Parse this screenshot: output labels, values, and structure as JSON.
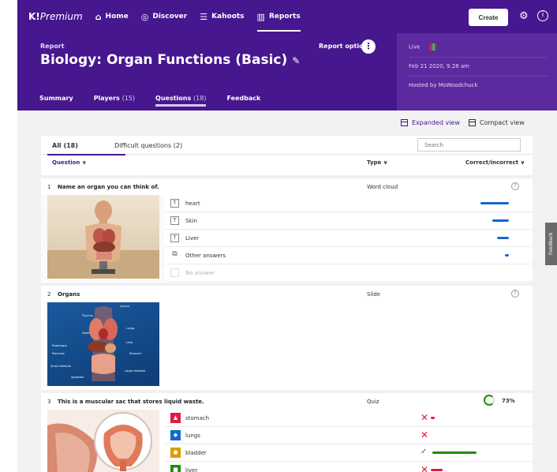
{
  "nav": {
    "logo_k": "K!",
    "logo_premium": "Premium",
    "items": [
      {
        "icon": "home-icon",
        "glyph": "⌂",
        "label": "Home"
      },
      {
        "icon": "compass-icon",
        "glyph": "◎",
        "label": "Discover"
      },
      {
        "icon": "list-icon",
        "glyph": "☰",
        "label": "Kahoots"
      },
      {
        "icon": "bar-chart-icon",
        "glyph": "▥",
        "label": "Reports"
      }
    ],
    "create_label": "Create"
  },
  "header": {
    "kicker": "Report",
    "title": "Biology: Organ Functions (Basic)",
    "report_options": "Report options",
    "tabs": [
      {
        "label": "Summary",
        "count": ""
      },
      {
        "label": "Players",
        "count": "(15)"
      },
      {
        "label": "Questions",
        "count": "(18)"
      },
      {
        "label": "Feedback",
        "count": ""
      }
    ],
    "live": "Live",
    "date": "Feb 21 2020, 9.28 am",
    "host": "Hosted by MsWoodchuck"
  },
  "views": {
    "expanded": "Expanded view",
    "compact": "Compact view"
  },
  "subtabs": {
    "all": "All (18)",
    "difficult": "Difficult questions (2)",
    "search_placeholder": "Search"
  },
  "columns": {
    "question": "Question ∨",
    "type": "Type ∨",
    "correct": "Correct/incorrect ∨"
  },
  "questions": [
    {
      "num": "1",
      "text": "Name an organ you can think of.",
      "type": "Word cloud",
      "answers": [
        {
          "label": "heart",
          "count": "7",
          "fill": 1.0
        },
        {
          "label": "Skin",
          "count": "4",
          "fill": 0.57
        },
        {
          "label": "Liver",
          "count": "3",
          "fill": 0.43
        },
        {
          "label": "Other answers",
          "count": "1",
          "fill": 0.14
        },
        {
          "label": "No answer",
          "count": "0",
          "fill": 0
        }
      ]
    },
    {
      "num": "2",
      "text": "Organs",
      "type": "Slide"
    },
    {
      "num": "3",
      "text": "This is a muscular sac that stores liquid waste.",
      "type": "Quiz",
      "percent": "73%",
      "answers": [
        {
          "label": "stomach",
          "count": "1",
          "correct": false,
          "shape_color": "#e21b3c",
          "fill": 0.09
        },
        {
          "label": "lungs",
          "count": "0",
          "correct": false,
          "shape_color": "#1368ce",
          "fill": 0
        },
        {
          "label": "bladder",
          "count": "11",
          "correct": true,
          "shape_color": "#d89e00",
          "fill": 1.0
        },
        {
          "label": "liver",
          "count": "3",
          "correct": false,
          "shape_color": "#26890c",
          "fill": 0.27
        }
      ]
    }
  ],
  "image_labels": [
    "Larynx",
    "Thymus",
    "Lungs",
    "Heart",
    "Liver",
    "Stomach",
    "Esophagus",
    "Pancreas",
    "Small intestine",
    "Large intestine",
    "Appendix"
  ],
  "feedback_tab": "Feedback",
  "colors": {
    "brand": "#46178f",
    "blue_bar": "#1368ce",
    "green": "#26890c",
    "red": "#e21b3c"
  }
}
